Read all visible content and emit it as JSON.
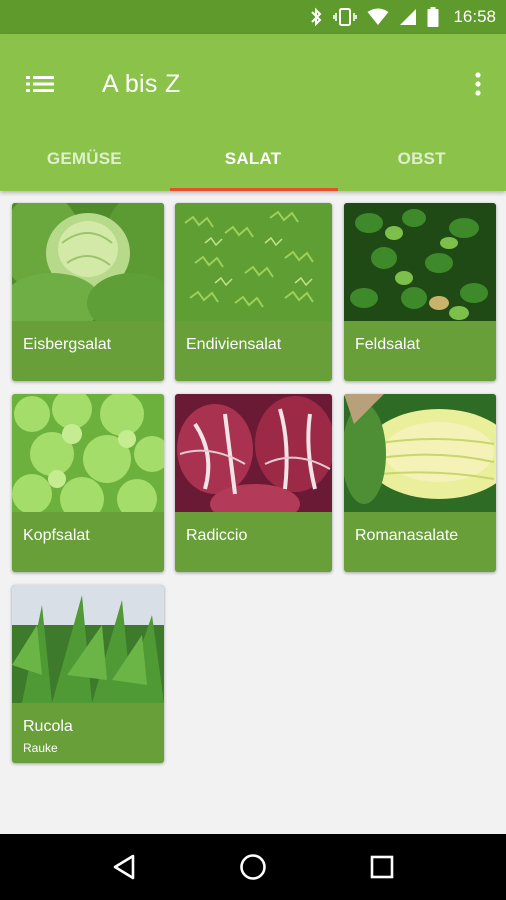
{
  "status_bar": {
    "time": "16:58",
    "icons": [
      "bluetooth-icon",
      "vibrate-icon",
      "wifi-icon",
      "signal-icon",
      "battery-icon"
    ]
  },
  "app_bar": {
    "title": "A bis Z",
    "menu_icon": "list-icon",
    "overflow_icon": "more-vert-icon"
  },
  "tabs": [
    {
      "label": "GEMÜSE",
      "active": false
    },
    {
      "label": "SALAT",
      "active": true
    },
    {
      "label": "OBST",
      "active": false
    }
  ],
  "cards": [
    {
      "label": "Eisbergsalat",
      "sublabel": ""
    },
    {
      "label": "Endiviensalat",
      "sublabel": ""
    },
    {
      "label": "Feldsalat",
      "sublabel": ""
    },
    {
      "label": "Kopfsalat",
      "sublabel": ""
    },
    {
      "label": "Radiccio",
      "sublabel": ""
    },
    {
      "label": "Romanasalate",
      "sublabel": ""
    },
    {
      "label": "Rucola",
      "sublabel": "Rauke"
    }
  ],
  "colors": {
    "primary": "#8bc34a",
    "primary_dark": "#5f9a2d",
    "card": "#689f38",
    "tab_indicator": "#e4502c"
  },
  "nav_bar": {
    "icons": [
      "back-icon",
      "home-icon",
      "recents-icon"
    ]
  }
}
